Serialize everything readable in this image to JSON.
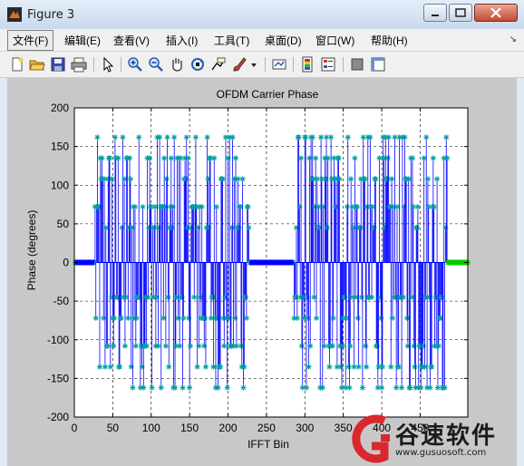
{
  "window": {
    "title": "Figure 3"
  },
  "menu": [
    "文件(F)",
    "编辑(E)",
    "查看(V)",
    "插入(I)",
    "工具(T)",
    "桌面(D)",
    "窗口(W)",
    "帮助(H)"
  ],
  "toolbar": {
    "buttons": [
      "new-figure-icon",
      "open-file-icon",
      "save-icon",
      "print-icon",
      "pointer-icon",
      "zoom-in-icon",
      "zoom-out-icon",
      "pan-icon",
      "rotate-3d-icon",
      "data-cursor-icon",
      "brush-icon",
      "link-plot-icon",
      "colorbar-icon",
      "legend-icon",
      "hide-plot-tools-icon",
      "show-plot-tools-icon"
    ]
  },
  "chart_data": {
    "type": "stem",
    "title": "OFDM Carrier Phase",
    "xlabel": "IFFT Bin",
    "ylabel": "Phase (degrees)",
    "xlim": [
      0,
      512
    ],
    "ylim": [
      -200,
      200
    ],
    "xticks": [
      0,
      50,
      100,
      150,
      200,
      250,
      300,
      350,
      400,
      450
    ],
    "yticks": [
      -200,
      -150,
      -100,
      -50,
      0,
      50,
      100,
      150,
      200
    ],
    "grid": true,
    "marker": "*",
    "colors": {
      "stem": "#0000ff",
      "marker": "#00a0a0",
      "tail": "#00cc00"
    },
    "allowed_phases": [
      -162,
      -135,
      -108,
      -72,
      -45,
      45,
      72,
      108,
      135,
      162
    ],
    "segments": [
      {
        "name": "zero-phase guard",
        "x_from": 1,
        "x_to": 26,
        "value": 0
      },
      {
        "name": "data carriers",
        "x_from": 27,
        "x_to": 227,
        "value": "random"
      },
      {
        "name": "zero-phase guard",
        "x_from": 228,
        "x_to": 285,
        "value": 0
      },
      {
        "name": "data carriers",
        "x_from": 286,
        "x_to": 485,
        "value": "random"
      },
      {
        "name": "zero-phase tail",
        "x_from": 486,
        "x_to": 512,
        "value": 0
      }
    ]
  },
  "watermark": {
    "brand": "谷速软件",
    "url": "www.gusuosoft.com"
  }
}
